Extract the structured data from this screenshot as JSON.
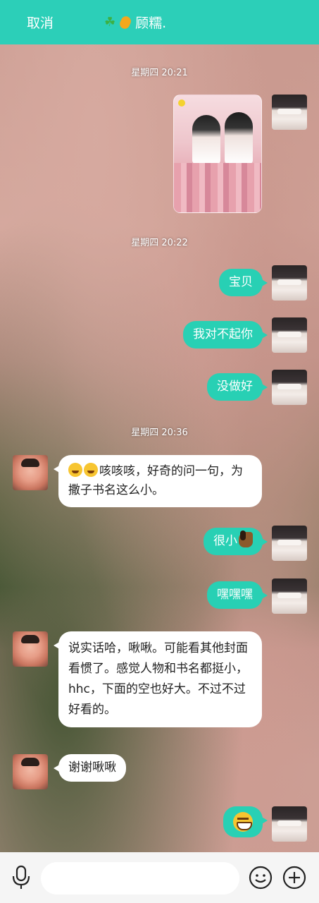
{
  "header": {
    "cancel_label": "取消",
    "contact_name": "顾糯."
  },
  "timestamps": [
    "星期四 20:21",
    "星期四 20:22",
    "星期四 20:36"
  ],
  "messages": [
    {
      "side": "right",
      "type": "image"
    },
    {
      "side": "right",
      "text": "宝贝"
    },
    {
      "side": "right",
      "text": "我对不起你"
    },
    {
      "side": "right",
      "text": "没做好"
    },
    {
      "side": "left",
      "text": "咳咳咳，好奇的问一句，为撒子书名这么小。",
      "emoji": "😂😂"
    },
    {
      "side": "right",
      "text": "很小",
      "emoji": "horse"
    },
    {
      "side": "right",
      "text": "嘿嘿嘿"
    },
    {
      "side": "left",
      "text": "说实话哈，啾啾。可能看其他封面看惯了。感觉人物和书名都挺小，hhc，下面的空也好大。不过不过好看的。"
    },
    {
      "side": "left",
      "text": "谢谢啾啾"
    },
    {
      "side": "right",
      "type": "emoji",
      "emoji": "grin"
    }
  ],
  "input": {
    "placeholder": ""
  },
  "colors": {
    "accent": "#2ccfb8",
    "bubble_right": "#28d0b4",
    "bubble_left": "#ffffff"
  },
  "icons": [
    "microphone-icon",
    "emoji-icon",
    "plus-icon",
    "clover-icon",
    "pill-icon"
  ]
}
